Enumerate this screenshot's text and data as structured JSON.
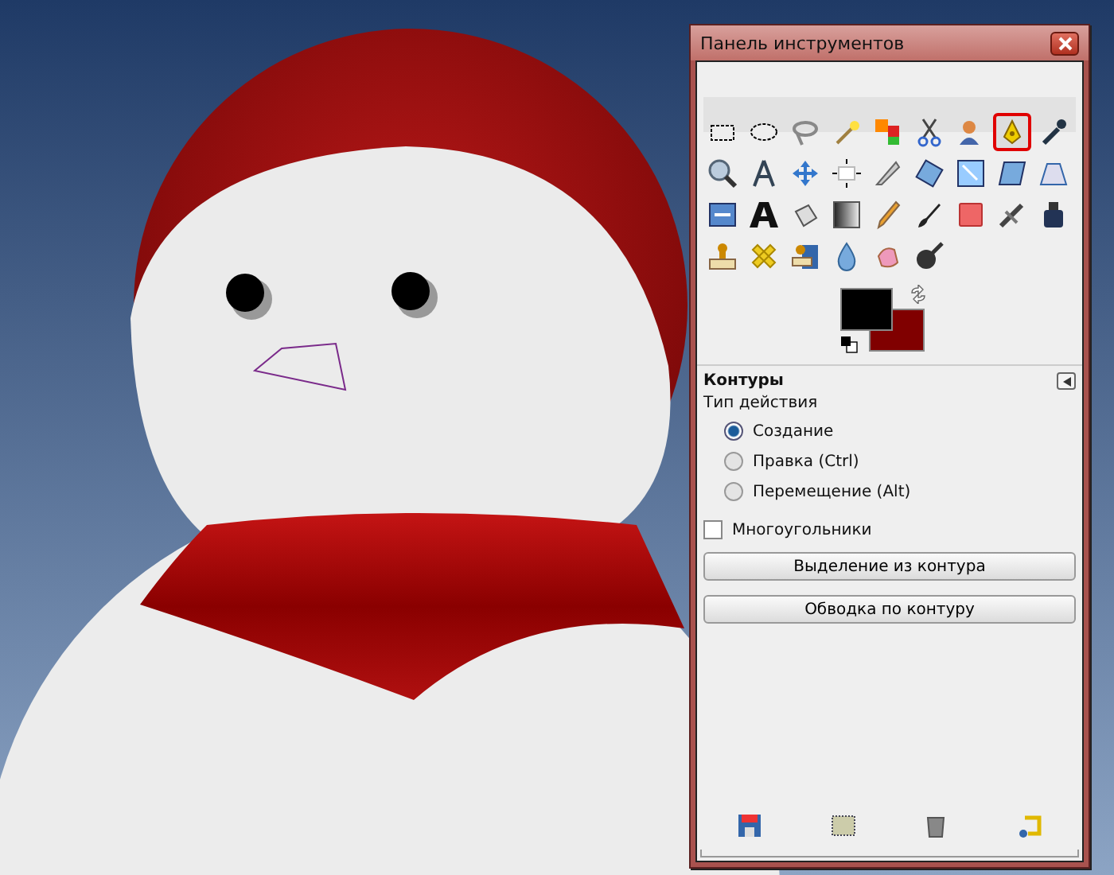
{
  "window": {
    "title": "Панель инструментов"
  },
  "tools": [
    {
      "selected": false
    },
    {
      "selected": false
    },
    {
      "selected": false
    },
    {
      "selected": false
    },
    {
      "selected": false
    },
    {
      "selected": false
    },
    {
      "selected": false
    },
    {
      "selected": true
    },
    {
      "selected": false
    },
    {
      "selected": false
    },
    {
      "selected": false
    },
    {
      "selected": false
    },
    {
      "selected": false
    },
    {
      "selected": false
    },
    {
      "selected": false
    },
    {
      "selected": false
    },
    {
      "selected": false
    },
    {
      "selected": false
    },
    {
      "selected": false
    },
    {
      "selected": false
    },
    {
      "selected": false
    },
    {
      "selected": false
    },
    {
      "selected": false
    },
    {
      "selected": false
    },
    {
      "selected": false
    },
    {
      "selected": false
    },
    {
      "selected": false
    },
    {
      "selected": false
    },
    {
      "selected": false
    },
    {
      "selected": false
    },
    {
      "selected": false
    },
    {
      "selected": false
    },
    {
      "selected": false
    }
  ],
  "swatches": [
    {
      "kind": "foreground",
      "color": "#000000"
    },
    {
      "kind": "background",
      "color": "#800000"
    }
  ],
  "options": {
    "title": "Контуры",
    "action_label": "Тип действия",
    "modes": [
      {
        "label": "Создание",
        "selected": true
      },
      {
        "label": "Правка (Ctrl)",
        "selected": false
      },
      {
        "label": "Перемещение (Alt)",
        "selected": false
      }
    ],
    "polygonal": {
      "label": "Многоугольники",
      "checked": false
    },
    "buttons": [
      "Выделение из контура",
      "Обводка по контуру"
    ]
  }
}
